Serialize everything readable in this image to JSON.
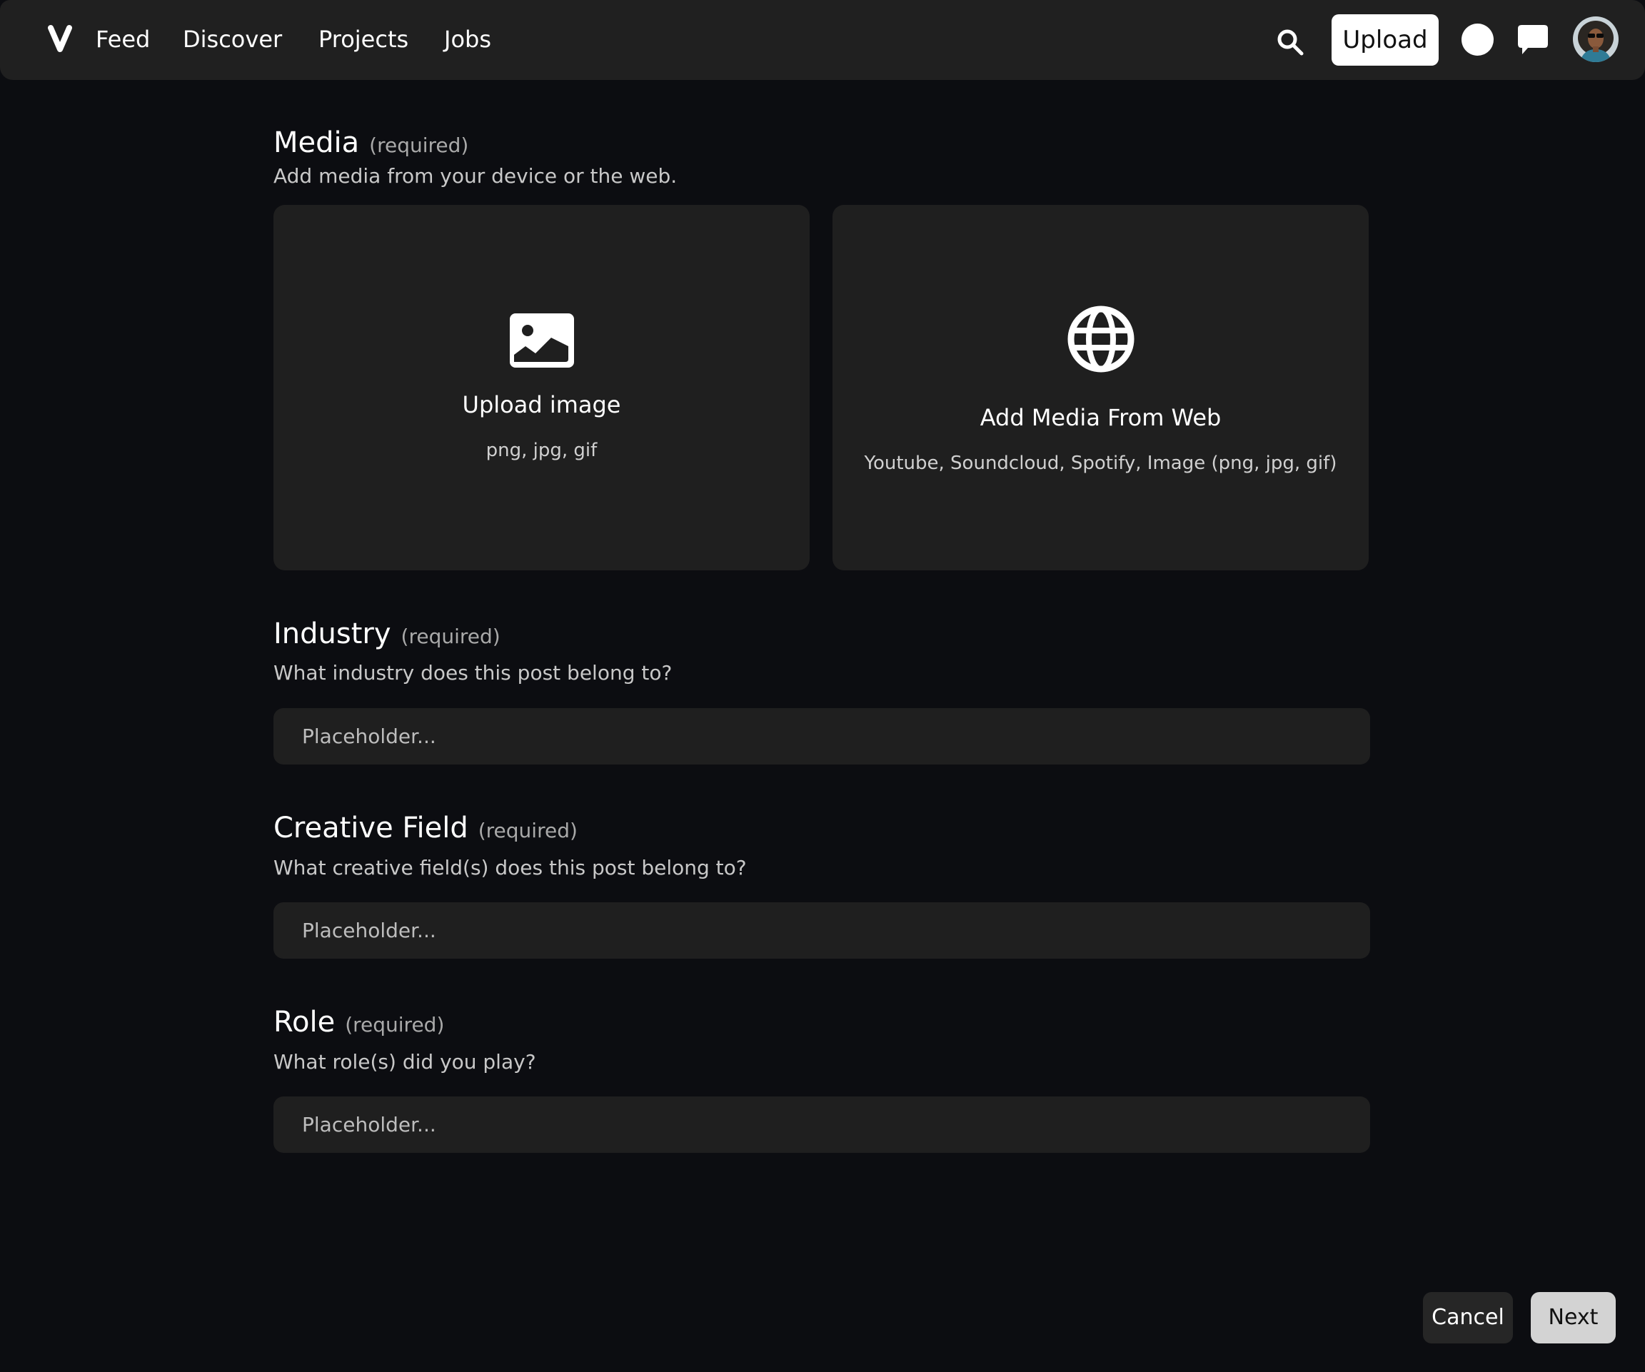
{
  "navbar": {
    "logo_icon": "v-logo-icon",
    "links": [
      {
        "label": "Feed"
      },
      {
        "label": "Discover"
      },
      {
        "label": "Projects"
      },
      {
        "label": "Jobs"
      }
    ],
    "search_icon": "search-icon",
    "upload_label": "Upload",
    "notification_icon": "notification-circle-icon",
    "chat_icon": "chat-bubble-icon",
    "avatar_icon": "user-avatar"
  },
  "media": {
    "title": "Media",
    "required": "(required)",
    "subtitle": "Add media from your device or the web.",
    "upload_card": {
      "icon": "image-icon",
      "title": "Upload image",
      "formats": "png, jpg, gif"
    },
    "web_card": {
      "icon": "globe-icon",
      "title": "Add Media From Web",
      "formats": "Youtube, Soundcloud, Spotify, Image (png, jpg, gif)"
    }
  },
  "industry": {
    "title": "Industry",
    "required": "(required)",
    "subtitle": "What industry does this post belong to?",
    "placeholder": "Placeholder...",
    "value": ""
  },
  "creative_field": {
    "title": "Creative Field",
    "required": "(required)",
    "subtitle": "What creative field(s) does this post belong to?",
    "placeholder": "Placeholder...",
    "value": ""
  },
  "role": {
    "title": "Role",
    "required": "(required)",
    "subtitle": "What role(s) did you play?",
    "placeholder": "Placeholder...",
    "value": ""
  },
  "footer": {
    "cancel_label": "Cancel",
    "next_label": "Next"
  },
  "colors": {
    "page_bg": "#0c0d11",
    "surface": "#1f1f1f",
    "navbar_bg": "#202020",
    "primary_button_bg": "#ffffff",
    "next_button_bg": "#d3d3d3",
    "cancel_button_bg": "#262626",
    "muted_text": "#a9a9a9"
  }
}
